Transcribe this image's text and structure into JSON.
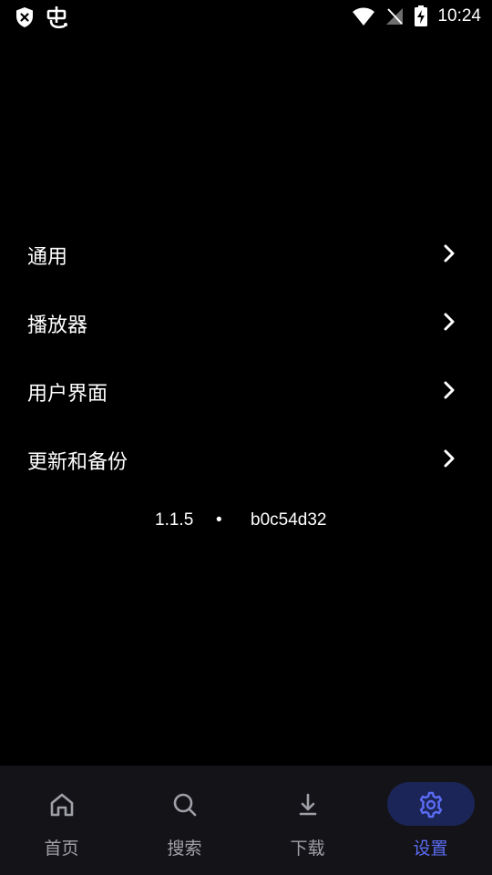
{
  "status_bar": {
    "time": "10:24"
  },
  "settings_menu": {
    "items": [
      {
        "label": "通用"
      },
      {
        "label": "播放器"
      },
      {
        "label": "用户界面"
      },
      {
        "label": "更新和备份"
      }
    ]
  },
  "version": {
    "number": "1.1.5",
    "separator": "•",
    "hash": "b0c54d32"
  },
  "bottom_nav": {
    "items": [
      {
        "label": "首页",
        "icon": "home-icon"
      },
      {
        "label": "搜索",
        "icon": "search-icon"
      },
      {
        "label": "下载",
        "icon": "download-icon"
      },
      {
        "label": "设置",
        "icon": "gear-icon"
      }
    ],
    "active": "设置"
  },
  "colors": {
    "background": "#000000",
    "nav_background": "#141418",
    "accent": "#5b6cf5",
    "active_pill": "#1c2557",
    "inactive_text": "#a0a0a8"
  }
}
